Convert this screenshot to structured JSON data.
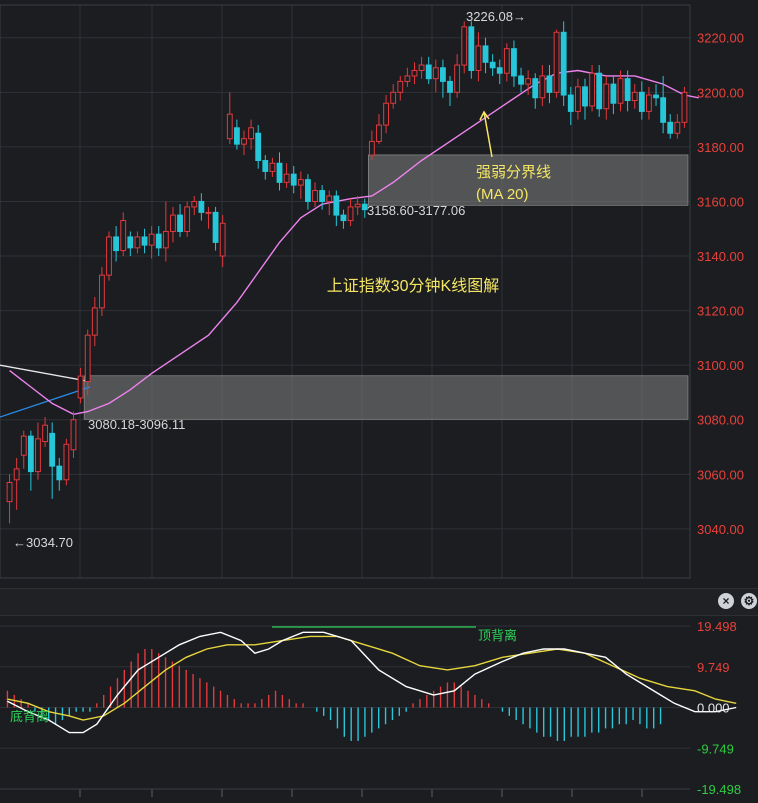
{
  "colors": {
    "up": "#e2393d",
    "down": "#27c6d9",
    "ma20": "#ee82ee",
    "dif": "#ffffff",
    "dea": "#e6d53c",
    "grid": "#2e3136",
    "axis_text": "#e8413a",
    "axis_text_neg": "#2ecc40",
    "annotation": "#f5e663",
    "label": "#d8d8d8",
    "zone": "rgba(130,130,130,0.55)",
    "divergence": "#2ed15a"
  },
  "chart_data": [
    {
      "type": "candlestick",
      "title": "上证指数30分钟K线图解",
      "y_ticks": [
        "3220.00",
        "3200.00",
        "3180.00",
        "3160.00",
        "3140.00",
        "3120.00",
        "3100.00",
        "3080.00",
        "3060.00",
        "3040.00"
      ],
      "ylim": [
        3022,
        3232
      ],
      "annotations": {
        "high": "3226.08→",
        "low": "←3034.70",
        "zone_upper": "3158.60-3177.06",
        "zone_lower": "3080.18-3096.11",
        "ma_label_line1": "强弱分界线",
        "ma_label_line2": "(MA 20)"
      },
      "zones": [
        {
          "low": 3158.6,
          "high": 3177.06,
          "from": 51,
          "to": 97
        },
        {
          "low": 3080.18,
          "high": 3096.11,
          "from": 11,
          "to": 97
        }
      ],
      "candles": [
        [
          3050,
          3057,
          3042,
          3060
        ],
        [
          3058,
          3062,
          3047,
          3066
        ],
        [
          3067,
          3074,
          3062,
          3076
        ],
        [
          3074,
          3061,
          3054,
          3076
        ],
        [
          3061,
          3073,
          3058,
          3079
        ],
        [
          3072,
          3078,
          3070,
          3081
        ],
        [
          3075,
          3063,
          3051,
          3079
        ],
        [
          3063,
          3058,
          3054,
          3066
        ],
        [
          3058,
          3071,
          3056,
          3073
        ],
        [
          3069,
          3080,
          3066,
          3083
        ],
        [
          3088,
          3096,
          3086,
          3099
        ],
        [
          3094,
          3111,
          3089,
          3113
        ],
        [
          3111,
          3121,
          3107,
          3125
        ],
        [
          3121,
          3133,
          3118,
          3136
        ],
        [
          3133,
          3147,
          3131,
          3149
        ],
        [
          3147,
          3142,
          3138,
          3151
        ],
        [
          3142,
          3153,
          3140,
          3156
        ],
        [
          3147,
          3143,
          3140,
          3149
        ],
        [
          3143,
          3147,
          3141,
          3149
        ],
        [
          3147,
          3144,
          3141,
          3150
        ],
        [
          3144,
          3148,
          3139,
          3151
        ],
        [
          3148,
          3143,
          3140,
          3151
        ],
        [
          3143,
          3149,
          3138,
          3160
        ],
        [
          3149,
          3155,
          3145,
          3158
        ],
        [
          3155,
          3149,
          3147,
          3159
        ],
        [
          3149,
          3158,
          3147,
          3160
        ],
        [
          3158,
          3160,
          3155,
          3162
        ],
        [
          3160,
          3156,
          3153,
          3163
        ],
        [
          3156,
          3156,
          3150,
          3158
        ],
        [
          3156,
          3145,
          3142,
          3158
        ],
        [
          3140,
          3152,
          3136,
          3155
        ],
        [
          3183,
          3192,
          3181,
          3200
        ],
        [
          3187,
          3181,
          3179,
          3190
        ],
        [
          3181,
          3183,
          3177,
          3186
        ],
        [
          3183,
          3187,
          3179,
          3190
        ],
        [
          3185,
          3175,
          3172,
          3188
        ],
        [
          3175,
          3171,
          3168,
          3177
        ],
        [
          3171,
          3174,
          3169,
          3176
        ],
        [
          3174,
          3167,
          3164,
          3178
        ],
        [
          3167,
          3170,
          3165,
          3174
        ],
        [
          3170,
          3166,
          3163,
          3173
        ],
        [
          3166,
          3168,
          3161,
          3171
        ],
        [
          3168,
          3160,
          3157,
          3170
        ],
        [
          3160,
          3164,
          3158,
          3167
        ],
        [
          3164,
          3160,
          3157,
          3166
        ],
        [
          3160,
          3162,
          3155,
          3164
        ],
        [
          3162,
          3155,
          3151,
          3164
        ],
        [
          3155,
          3153,
          3150,
          3157
        ],
        [
          3153,
          3158,
          3151,
          3161
        ],
        [
          3158,
          3159,
          3155,
          3162
        ],
        [
          3159,
          3157,
          3154,
          3161
        ],
        [
          3177,
          3182,
          3175,
          3186
        ],
        [
          3182,
          3188,
          3181,
          3192
        ],
        [
          3188,
          3196,
          3185,
          3199
        ],
        [
          3196,
          3200,
          3194,
          3203
        ],
        [
          3200,
          3204,
          3197,
          3206
        ],
        [
          3204,
          3206,
          3202,
          3209
        ],
        [
          3206,
          3208,
          3203,
          3211
        ],
        [
          3208,
          3210,
          3205,
          3213
        ],
        [
          3210,
          3205,
          3203,
          3213
        ],
        [
          3205,
          3209,
          3200,
          3212
        ],
        [
          3209,
          3204,
          3198,
          3212
        ],
        [
          3204,
          3200,
          3195,
          3206
        ],
        [
          3200,
          3210,
          3198,
          3214
        ],
        [
          3210,
          3224,
          3207,
          3226
        ],
        [
          3224,
          3208,
          3205,
          3226
        ],
        [
          3208,
          3217,
          3204,
          3222
        ],
        [
          3217,
          3211,
          3207,
          3220
        ],
        [
          3211,
          3209,
          3206,
          3214
        ],
        [
          3209,
          3207,
          3203,
          3212
        ],
        [
          3207,
          3216,
          3204,
          3218
        ],
        [
          3216,
          3206,
          3202,
          3219
        ],
        [
          3206,
          3203,
          3200,
          3209
        ],
        [
          3203,
          3205,
          3199,
          3208
        ],
        [
          3205,
          3198,
          3194,
          3207
        ],
        [
          3198,
          3206,
          3195,
          3210
        ],
        [
          3206,
          3200,
          3196,
          3210
        ],
        [
          3200,
          3222,
          3198,
          3223
        ],
        [
          3222,
          3199,
          3195,
          3226
        ],
        [
          3199,
          3193,
          3188,
          3202
        ],
        [
          3193,
          3202,
          3190,
          3205
        ],
        [
          3202,
          3195,
          3190,
          3205
        ],
        [
          3195,
          3207,
          3193,
          3210
        ],
        [
          3207,
          3194,
          3191,
          3210
        ],
        [
          3194,
          3203,
          3190,
          3206
        ],
        [
          3203,
          3196,
          3192,
          3206
        ],
        [
          3196,
          3205,
          3193,
          3208
        ],
        [
          3205,
          3197,
          3193,
          3208
        ],
        [
          3197,
          3200,
          3194,
          3203
        ],
        [
          3200,
          3193,
          3190,
          3204
        ],
        [
          3193,
          3199,
          3190,
          3202
        ],
        [
          3199,
          3198,
          3195,
          3203
        ],
        [
          3198,
          3189,
          3185,
          3206
        ],
        [
          3189,
          3185,
          3183,
          3192
        ],
        [
          3185,
          3189,
          3183,
          3192
        ],
        [
          3189,
          3200,
          3187,
          3202
        ]
      ],
      "ma20": [
        [
          0,
          3098
        ],
        [
          3,
          3092
        ],
        [
          6,
          3086
        ],
        [
          9,
          3082
        ],
        [
          11,
          3083
        ],
        [
          14,
          3086
        ],
        [
          17,
          3091
        ],
        [
          20,
          3097
        ],
        [
          24,
          3104
        ],
        [
          28,
          3111
        ],
        [
          32,
          3123
        ],
        [
          35,
          3134
        ],
        [
          38,
          3145
        ],
        [
          41,
          3154
        ],
        [
          44,
          3159
        ],
        [
          48,
          3161
        ],
        [
          51,
          3162
        ],
        [
          54,
          3167
        ],
        [
          58,
          3175
        ],
        [
          62,
          3182
        ],
        [
          66,
          3189
        ],
        [
          70,
          3196
        ],
        [
          74,
          3203
        ],
        [
          77,
          3207
        ],
        [
          80,
          3208
        ],
        [
          84,
          3206
        ],
        [
          88,
          3206
        ],
        [
          92,
          3203
        ],
        [
          95,
          3199
        ],
        [
          97,
          3198
        ]
      ]
    },
    {
      "type": "macd",
      "y_ticks": [
        "19.498",
        "9.749",
        "0.000",
        "-9.749",
        "-19.498"
      ],
      "ylim": [
        -19.498,
        19.498
      ],
      "annotations": {
        "divergence_left": "底背离",
        "divergence_right": "顶背离"
      },
      "histogram": [
        4,
        3,
        2,
        1,
        -1,
        -2,
        -3,
        -4,
        -3,
        -2,
        -1,
        -1,
        -1,
        1,
        3,
        5,
        7,
        9,
        11,
        13,
        14,
        14,
        13,
        12,
        11,
        10,
        9,
        8,
        7,
        6,
        5,
        4,
        3,
        2,
        1,
        1,
        1,
        2,
        3,
        4,
        3,
        2,
        1,
        1,
        0,
        -1,
        -2,
        -3,
        -5,
        -7,
        -8,
        -8,
        -7,
        -6,
        -5,
        -4,
        -3,
        -2,
        -1,
        1,
        2,
        3,
        4,
        5,
        6,
        6,
        5,
        4,
        3,
        2,
        1,
        0,
        -1,
        -2,
        -3,
        -4,
        -5,
        -6,
        -7,
        -7,
        -8,
        -8,
        -7,
        -7,
        -7,
        -6,
        -6,
        -5,
        -5,
        -4,
        -4,
        -3,
        -4,
        -5,
        -5,
        -4
      ],
      "dif": [
        [
          0,
          1.5
        ],
        [
          3,
          -1
        ],
        [
          6,
          -3
        ],
        [
          9,
          -6
        ],
        [
          11,
          -6
        ],
        [
          13,
          -4
        ],
        [
          16,
          3
        ],
        [
          19,
          9
        ],
        [
          22,
          12
        ],
        [
          25,
          15
        ],
        [
          28,
          17
        ],
        [
          31,
          18
        ],
        [
          34,
          16
        ],
        [
          36,
          13
        ],
        [
          38,
          14
        ],
        [
          40,
          16
        ],
        [
          43,
          18
        ],
        [
          46,
          18
        ],
        [
          50,
          16
        ],
        [
          54,
          9
        ],
        [
          58,
          5
        ],
        [
          62,
          3
        ],
        [
          65,
          4
        ],
        [
          68,
          8
        ],
        [
          72,
          11
        ],
        [
          75,
          13
        ],
        [
          78,
          14
        ],
        [
          81,
          14
        ],
        [
          84,
          13
        ],
        [
          87,
          12
        ],
        [
          90,
          8
        ],
        [
          93,
          5
        ],
        [
          95,
          3
        ],
        [
          97,
          1
        ],
        [
          100,
          -1
        ],
        [
          103,
          -1
        ],
        [
          106,
          0
        ]
      ],
      "dea": [
        [
          0,
          2
        ],
        [
          3,
          1
        ],
        [
          6,
          -1
        ],
        [
          9,
          -2
        ],
        [
          11,
          -3
        ],
        [
          14,
          -2
        ],
        [
          17,
          1
        ],
        [
          20,
          5
        ],
        [
          23,
          9
        ],
        [
          26,
          12
        ],
        [
          29,
          14
        ],
        [
          32,
          15
        ],
        [
          36,
          15
        ],
        [
          40,
          16
        ],
        [
          44,
          17
        ],
        [
          48,
          17
        ],
        [
          52,
          15
        ],
        [
          56,
          13
        ],
        [
          60,
          10
        ],
        [
          64,
          9
        ],
        [
          68,
          10
        ],
        [
          72,
          12
        ],
        [
          76,
          13
        ],
        [
          80,
          14
        ],
        [
          84,
          13
        ],
        [
          88,
          10
        ],
        [
          92,
          7
        ],
        [
          96,
          5
        ],
        [
          100,
          4
        ],
        [
          103,
          2
        ],
        [
          106,
          1
        ]
      ]
    }
  ]
}
